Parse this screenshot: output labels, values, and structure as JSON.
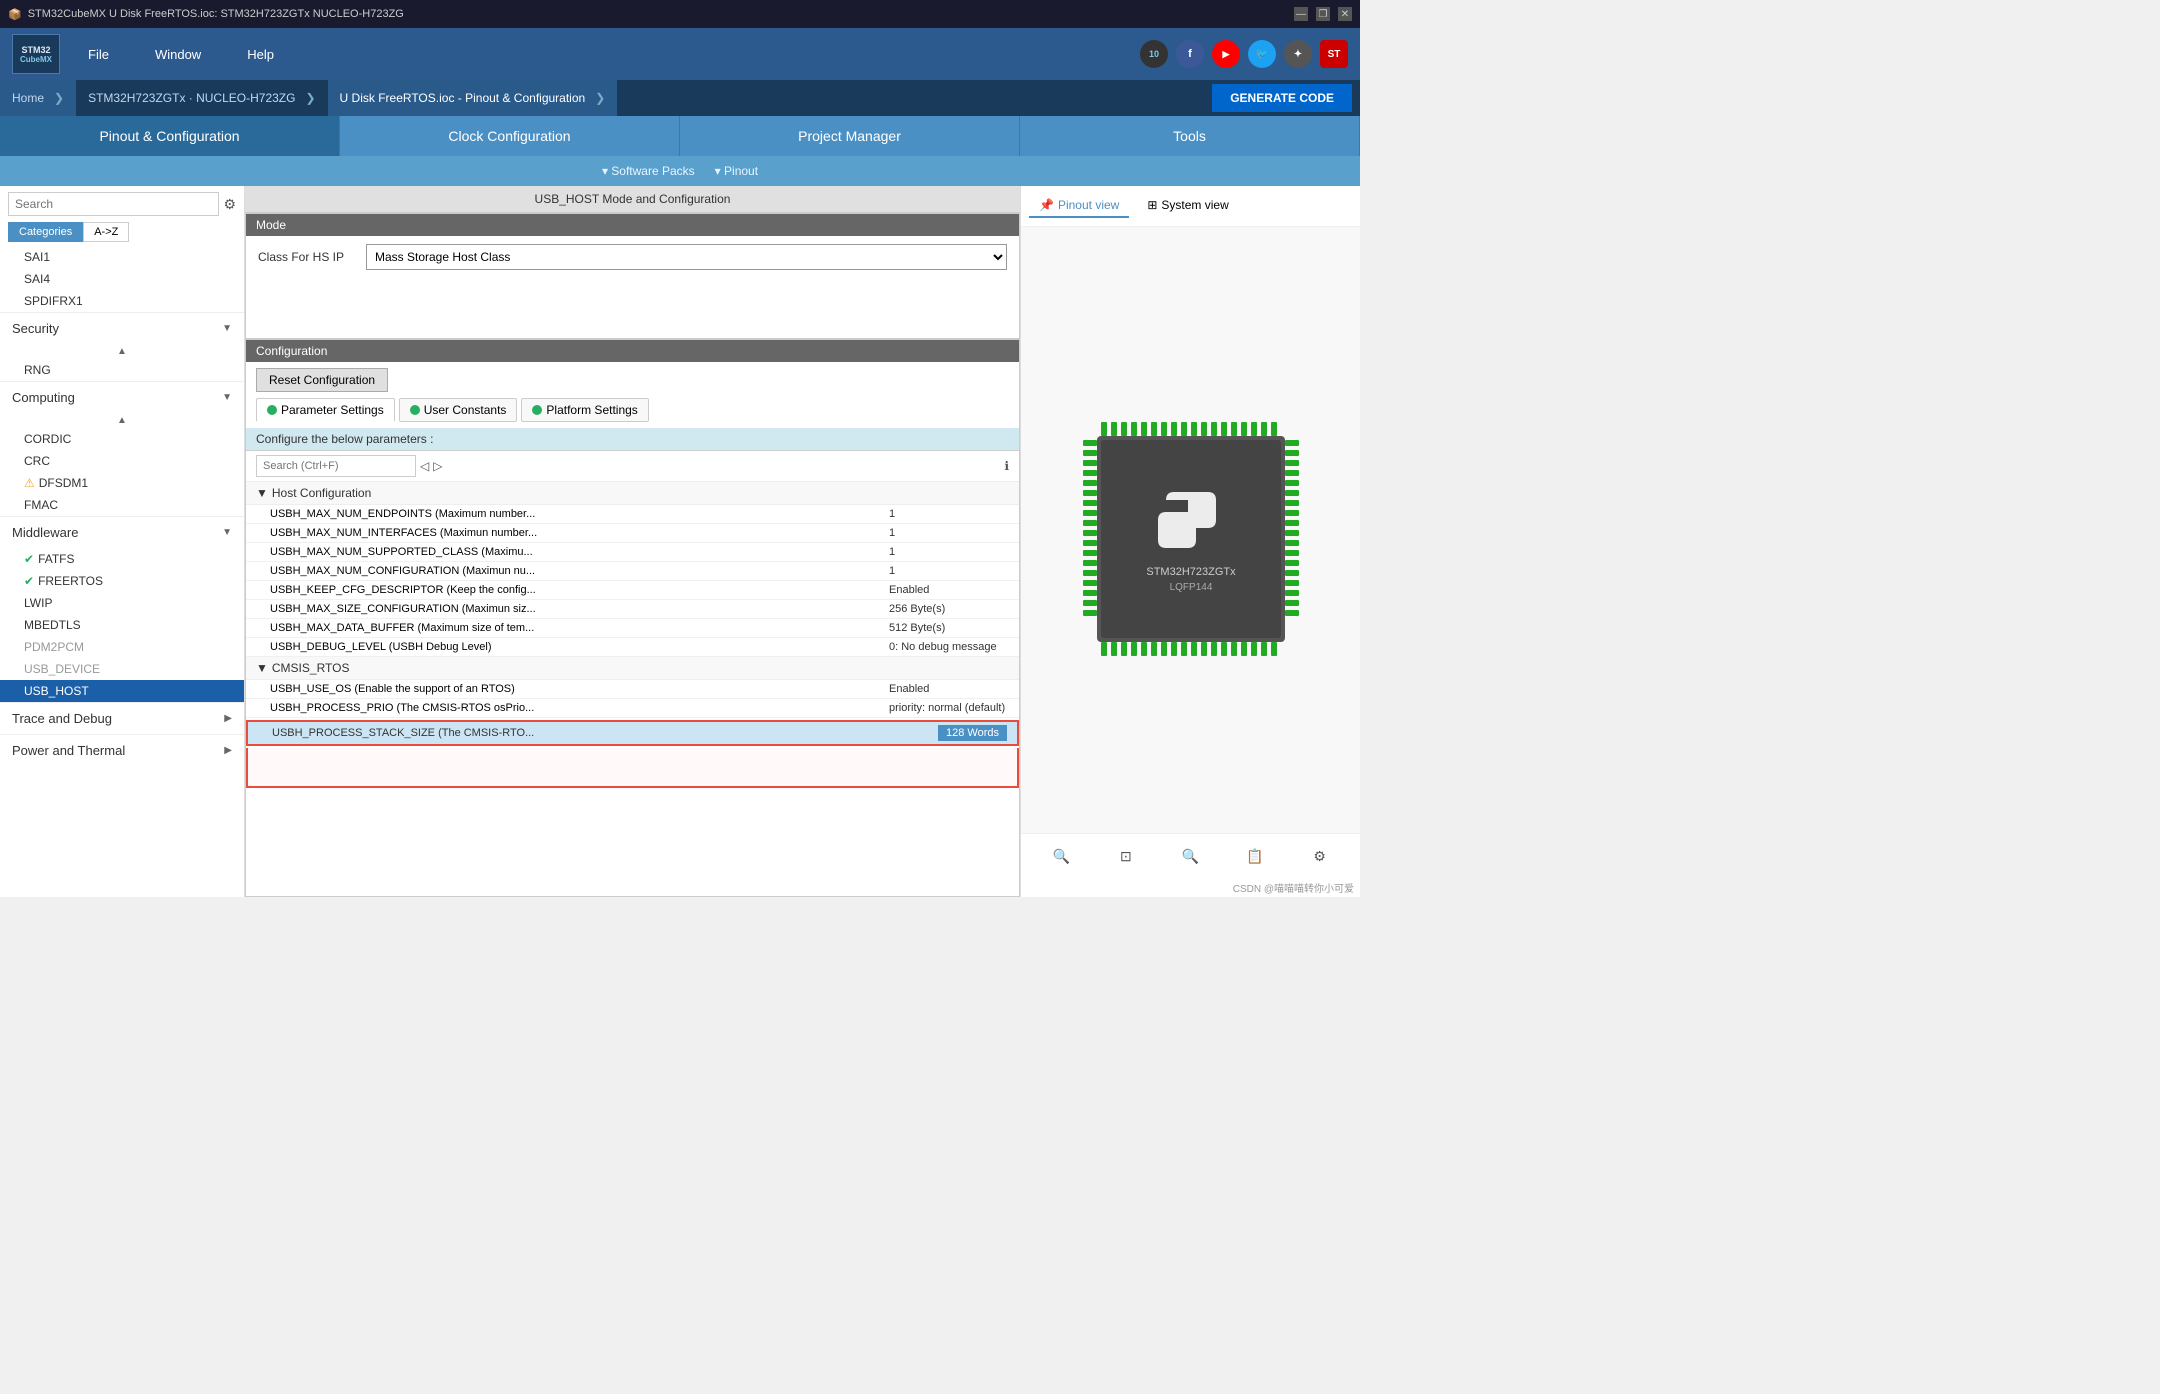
{
  "window": {
    "title": "STM32CubeMX U Disk FreeRTOS.ioc: STM32H723ZGTx NUCLEO-H723ZG"
  },
  "titlebar": {
    "minimize": "—",
    "maximize": "❐",
    "close": "✕"
  },
  "menubar": {
    "logo_line1": "STM32",
    "logo_line2": "CubeMX",
    "items": [
      "File",
      "Window",
      "Help"
    ]
  },
  "breadcrumb": {
    "items": [
      "Home",
      "STM32H723ZGTx · NUCLEO-H723ZG",
      "U Disk FreeRTOS.ioc - Pinout & Configuration"
    ]
  },
  "generate_btn": "GENERATE CODE",
  "main_tabs": [
    {
      "id": "pinout",
      "label": "Pinout & Configuration",
      "active": true
    },
    {
      "id": "clock",
      "label": "Clock Configuration"
    },
    {
      "id": "project",
      "label": "Project Manager"
    },
    {
      "id": "tools",
      "label": "Tools"
    }
  ],
  "sub_tabs": [
    "▾ Software Packs",
    "▾ Pinout"
  ],
  "sidebar": {
    "search_placeholder": "Search",
    "tabs": [
      "Categories",
      "A->Z"
    ],
    "active_tab": "Categories",
    "items_above": [
      "SAI1",
      "SAI4",
      "SPDIFRX1"
    ],
    "security_section": {
      "label": "Security",
      "items": [
        "RNG"
      ]
    },
    "computing_section": {
      "label": "Computing",
      "items": [
        "CORDIC",
        "CRC",
        "DFSDM1",
        "FMAC"
      ]
    },
    "middleware_section": {
      "label": "Middleware",
      "items": [
        {
          "label": "FATFS",
          "status": "check"
        },
        {
          "label": "FREERTOS",
          "status": "check"
        },
        {
          "label": "LWIP",
          "status": "none"
        },
        {
          "label": "MBEDTLS",
          "status": "none"
        },
        {
          "label": "PDM2PCM",
          "status": "none",
          "disabled": true
        },
        {
          "label": "USB_DEVICE",
          "status": "none",
          "disabled": true
        },
        {
          "label": "USB_HOST",
          "status": "none",
          "active": true
        }
      ]
    },
    "trace_section": {
      "label": "Trace and Debug"
    },
    "power_section": {
      "label": "Power and Thermal"
    }
  },
  "content": {
    "panel_title": "USB_HOST Mode and Configuration",
    "mode_section": {
      "header": "Mode",
      "class_label": "Class For HS IP",
      "class_value": "Mass Storage Host Class"
    },
    "config_section": {
      "header": "Configuration",
      "reset_btn": "Reset Configuration",
      "tabs": [
        {
          "label": "Parameter Settings",
          "dot_color": "#27ae60"
        },
        {
          "label": "User Constants",
          "dot_color": "#27ae60"
        },
        {
          "label": "Platform Settings",
          "dot_color": "#27ae60"
        }
      ],
      "params_label": "Configure the below parameters :",
      "search_placeholder": "Search (Ctrl+F)"
    },
    "host_config": {
      "group_label": "Host Configuration",
      "params": [
        {
          "name": "USBH_MAX_NUM_ENDPOINTS (Maximum number...",
          "value": "1"
        },
        {
          "name": "USBH_MAX_NUM_INTERFACES (Maximun number...",
          "value": "1"
        },
        {
          "name": "USBH_MAX_NUM_SUPPORTED_CLASS (Maximu...",
          "value": "1"
        },
        {
          "name": "USBH_MAX_NUM_CONFIGURATION (Maximun nu...",
          "value": "1"
        },
        {
          "name": "USBH_KEEP_CFG_DESCRIPTOR (Keep the config...",
          "value": "Enabled"
        },
        {
          "name": "USBH_MAX_SIZE_CONFIGURATION (Maximun siz...",
          "value": "256 Byte(s)"
        },
        {
          "name": "USBH_MAX_DATA_BUFFER (Maximum size of tem...",
          "value": "512 Byte(s)"
        },
        {
          "name": "USBH_DEBUG_LEVEL (USBH Debug Level)",
          "value": "0: No debug message"
        }
      ]
    },
    "cmsis_rtos": {
      "group_label": "CMSIS_RTOS",
      "params": [
        {
          "name": "USBH_USE_OS (Enable the support of an RTOS)",
          "value": "Enabled"
        },
        {
          "name": "USBH_PROCESS_PRIO (The CMSIS-RTOS osPrio...",
          "value": "priority: normal (default)"
        },
        {
          "name": "USBH_PROCESS_STACK_SIZE (The CMSIS-RTO...",
          "value": "128 Words",
          "selected": true
        }
      ]
    }
  },
  "right_panel": {
    "view_tabs": [
      "Pinout view",
      "System view"
    ],
    "chip_label": "STM32H723ZGTx",
    "chip_package": "LQFP144"
  },
  "watermark": "CSDN @喵喵喵转你小可爱"
}
